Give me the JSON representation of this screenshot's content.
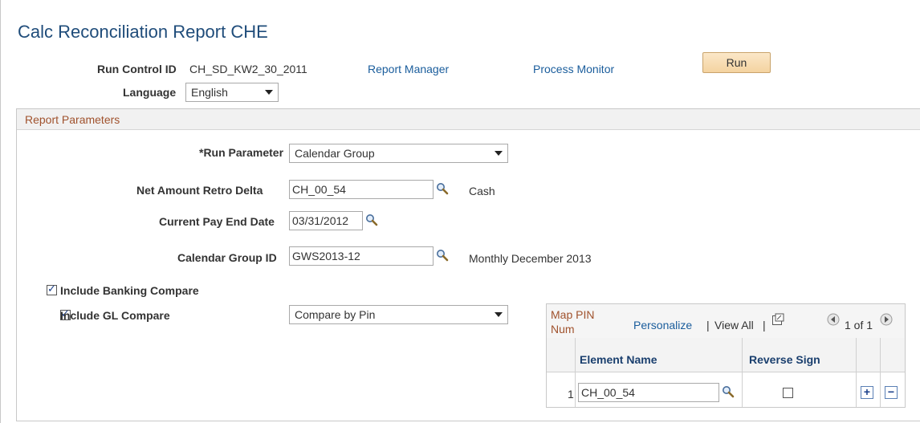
{
  "page": {
    "title": "Calc Reconciliation Report CHE"
  },
  "run_control": {
    "id_label": "Run Control ID",
    "id_value": "CH_SD_KW2_30_2011",
    "report_manager": "Report Manager",
    "process_monitor": "Process Monitor",
    "run_button": "Run",
    "language_label": "Language",
    "language_value": "English"
  },
  "report_parameters": {
    "header": "Report Parameters",
    "run_parameter_label": "*Run Parameter",
    "run_parameter_value": "Calendar Group",
    "net_amount_label": "Net Amount Retro Delta",
    "net_amount_value": "CH_00_54",
    "net_amount_desc": "Cash",
    "pay_end_label": "Current Pay End Date",
    "pay_end_value": "03/31/2012",
    "cal_group_label": "Calendar Group ID",
    "cal_group_value": "GWS2013-12",
    "cal_group_desc": "Monthly December 2013",
    "include_banking_label": "Include Banking Compare",
    "include_banking_checked": true,
    "include_gl_label": "Include GL Compare",
    "include_gl_checked": true,
    "compare_value": "Compare by Pin"
  },
  "map_pin_grid": {
    "title_line1": "Map PIN",
    "title_line2": "Num",
    "personalize": "Personalize",
    "sep1": "|",
    "view_all": "View All",
    "sep2": "|",
    "pager": "1 of 1",
    "col_element": "Element Name",
    "col_reverse": "Reverse Sign",
    "rows": [
      {
        "num": "1",
        "element": "CH_00_54",
        "reverse": false
      }
    ]
  },
  "colors": {
    "title": "#1f4c7a",
    "link": "#1a5d9c",
    "section_header_text": "#a0522d",
    "run_button": "#f4d3a0"
  }
}
